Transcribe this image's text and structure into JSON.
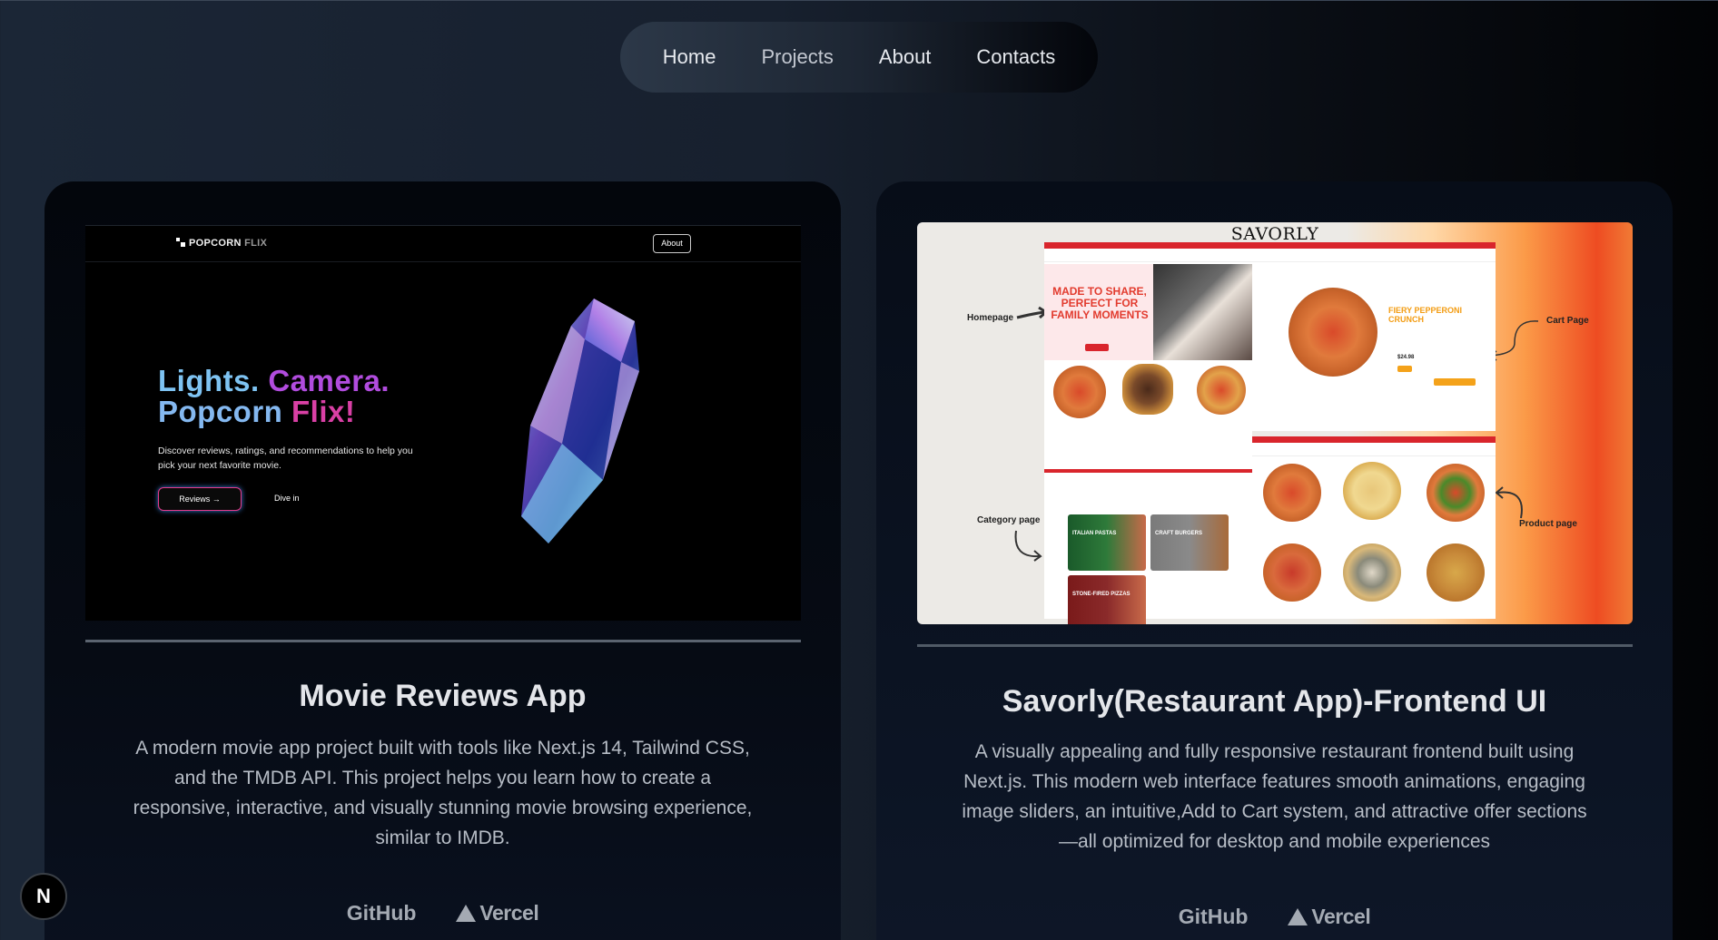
{
  "nav": {
    "items": [
      "Home",
      "Projects",
      "About",
      "Contacts"
    ]
  },
  "projects": [
    {
      "title": "Movie Reviews App",
      "description": "A modern movie app project built with tools like Next.js 14, Tailwind CSS, and the TMDB API. This project helps you learn how to create a responsive, interactive, and visually stunning movie browsing experience, similar to IMDB.",
      "links": {
        "github": "GitHub",
        "vercel": "Vercel"
      },
      "screenshot": {
        "logo": "POPCORN",
        "logo_dim": "FLIX",
        "about": "About",
        "hero_line1_a": "Lights.",
        "hero_line1_b": "Camera.",
        "hero_line2_a": "Popcorn",
        "hero_line2_b": "Flix!",
        "subtitle": "Discover reviews, ratings, and recommendations to help you pick your next favorite movie.",
        "primary_button": "Reviews →",
        "secondary_button": "Dive in"
      }
    },
    {
      "title": "Savorly(Restaurant App)-Frontend UI",
      "description": "A visually appealing and fully responsive restaurant frontend built using Next.js. This modern web interface features smooth animations, engaging image sliders, an intuitive,Add to Cart system, and attractive offer sections —all optimized for desktop and mobile experiences",
      "links": {
        "github": "GitHub",
        "vercel": "Vercel"
      },
      "screenshot": {
        "brand": "SAVORLY",
        "label_homepage": "Homepage",
        "label_cart": "Cart Page",
        "label_category": "Category page",
        "label_product": "Product page",
        "hero_text": "MADE TO SHARE, PERFECT FOR FAMILY MOMENTS",
        "featured_item": "FIERY PEPPERONI CRUNCH",
        "price": "$24.98",
        "tile_pastas": "ITALIAN PASTAS",
        "tile_burgers": "CRAFT BURGERS",
        "tile_pizzas": "STONE-FIRED PIZZAS"
      }
    }
  ],
  "badge": {
    "letter": "N"
  }
}
